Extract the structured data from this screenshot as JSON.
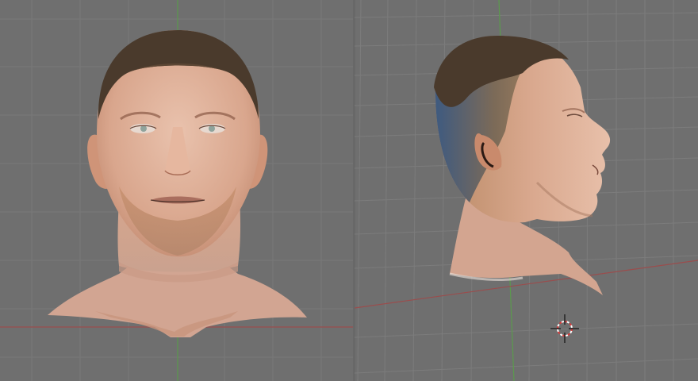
{
  "app": {
    "name": ""
  },
  "viewports": [
    {
      "id": "front",
      "view": "front",
      "subject": "head-mesh"
    },
    {
      "id": "side",
      "view": "perspective-side",
      "subject": "head-mesh"
    }
  ],
  "colors": {
    "background": "#6f6f6f",
    "grid_line": "#7a7a7a",
    "x_axis": "#9a4d4d",
    "y_axis": "#5b9a4d",
    "skin": "#d8a58c",
    "hair": "#4a3a2c",
    "cursor_red": "#d83a3a"
  },
  "icons": {
    "cursor": "3d-cursor-icon"
  }
}
